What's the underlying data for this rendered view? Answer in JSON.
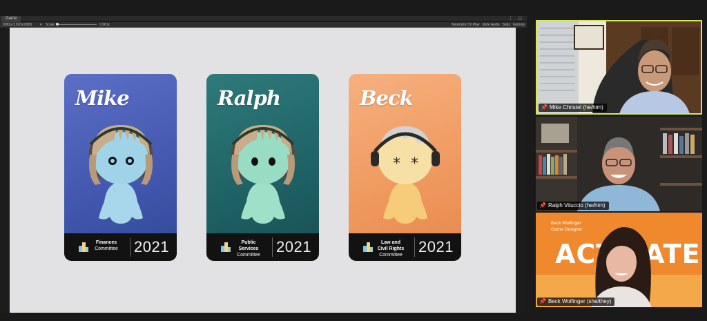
{
  "unity": {
    "tab_title": "Game",
    "resolution": "1080p (1920x1080)",
    "scale_label": "Scale",
    "scale_value": "0.961x",
    "toolbar_right": [
      "Maximize On Play",
      "Mute Audio",
      "Stats",
      "Gizmos"
    ]
  },
  "cards": [
    {
      "name": "Mike",
      "committee_line1": "Finances",
      "committee_line2": "",
      "committee_sub": "Committee",
      "year": "2021",
      "bg": "#4458b0"
    },
    {
      "name": "Ralph",
      "committee_line1": "Public",
      "committee_line2": "Services",
      "committee_sub": "Committee",
      "year": "2021",
      "bg": "#1f6366"
    },
    {
      "name": "Beck",
      "committee_line1": "Law and",
      "committee_line2": "Civil Rights",
      "committee_sub": "Committee",
      "year": "2021",
      "bg": "#f09a60"
    }
  ],
  "participants": [
    {
      "name": "Mike Christel (he/him)",
      "active_speaker": true
    },
    {
      "name": "Ralph Vituccio (he/him)",
      "active_speaker": false
    },
    {
      "name": "Beck Wolfinger (she/they)",
      "active_speaker": false,
      "background_line1": "Beck Wolfinger",
      "background_line2": "Game Designer",
      "background_word": "ACTIVATE"
    }
  ],
  "colors": {
    "active_speaker_border": "#d4e85a",
    "viewport_bg": "#e2e2e5"
  }
}
